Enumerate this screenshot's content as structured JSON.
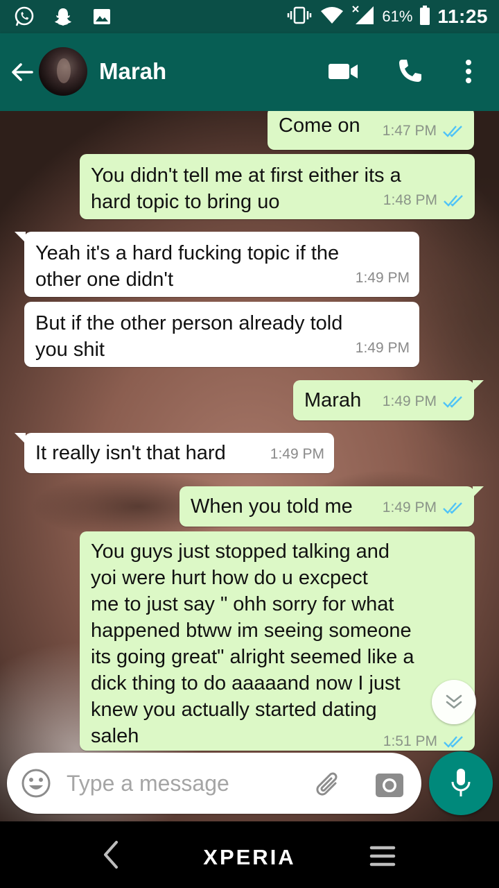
{
  "status_bar": {
    "battery_percent": "61%",
    "time": "11:25",
    "icons": [
      "whatsapp-icon",
      "snapchat-icon",
      "gallery-icon",
      "vibrate-icon",
      "wifi-icon",
      "signal-icon",
      "battery-icon"
    ]
  },
  "header": {
    "contact_name": "Marah",
    "icons": [
      "back-arrow-icon",
      "video-call-icon",
      "phone-icon",
      "more-vert-icon"
    ]
  },
  "messages": [
    {
      "dir": "out",
      "text": "Come on",
      "time": "1:47 PM",
      "ticks": "read"
    },
    {
      "dir": "out",
      "text": "You didn't tell me at first either its a\nhard topic to bring uo",
      "time": "1:48 PM",
      "ticks": "read"
    },
    {
      "dir": "in",
      "text": "Yeah it's a hard fucking topic if the\nother one didn't",
      "time": "1:49 PM"
    },
    {
      "dir": "in",
      "text": "But if the other person already told\nyou shit",
      "time": "1:49 PM"
    },
    {
      "dir": "out",
      "text": "Marah",
      "time": "1:49 PM",
      "ticks": "read"
    },
    {
      "dir": "in",
      "text": "It really isn't that hard",
      "time": "1:49 PM"
    },
    {
      "dir": "out",
      "text": "When you told me",
      "time": "1:49 PM",
      "ticks": "read"
    },
    {
      "dir": "out",
      "text": "You guys just stopped talking and\nyoi were hurt how do u excpect\nme to just say \" ohh sorry for what\nhappened btww im seeing someone\nits going great\" alright seemed like a\ndick thing to do aaaaand now I just\nknew you actually started dating\nsaleh",
      "time": "1:51 PM",
      "ticks": "read"
    }
  ],
  "composer": {
    "placeholder": "Type a message",
    "value": ""
  },
  "nav_bar": {
    "brand": "XPERIA"
  },
  "colors": {
    "toolbar": "#075e54",
    "status_bar": "#0b4f47",
    "outgoing_bubble": "#dcf8c6",
    "incoming_bubble": "#ffffff",
    "read_ticks": "#4fc3f7",
    "mic_button": "#00897b"
  }
}
